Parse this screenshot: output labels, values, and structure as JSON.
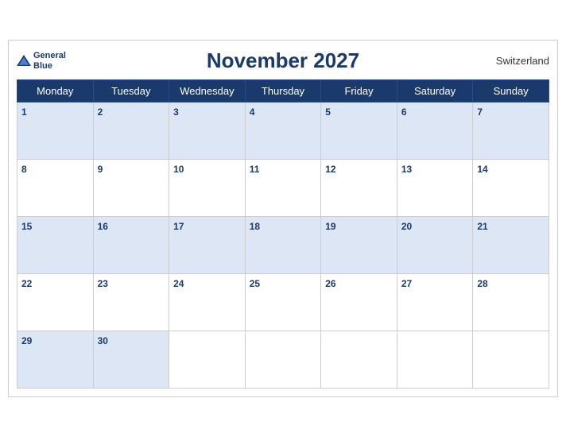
{
  "header": {
    "month_year": "November 2027",
    "country": "Switzerland",
    "logo_general": "General",
    "logo_blue": "Blue"
  },
  "weekdays": [
    "Monday",
    "Tuesday",
    "Wednesday",
    "Thursday",
    "Friday",
    "Saturday",
    "Sunday"
  ],
  "weeks": [
    [
      1,
      2,
      3,
      4,
      5,
      6,
      7
    ],
    [
      8,
      9,
      10,
      11,
      12,
      13,
      14
    ],
    [
      15,
      16,
      17,
      18,
      19,
      20,
      21
    ],
    [
      22,
      23,
      24,
      25,
      26,
      27,
      28
    ],
    [
      29,
      30,
      null,
      null,
      null,
      null,
      null
    ]
  ]
}
